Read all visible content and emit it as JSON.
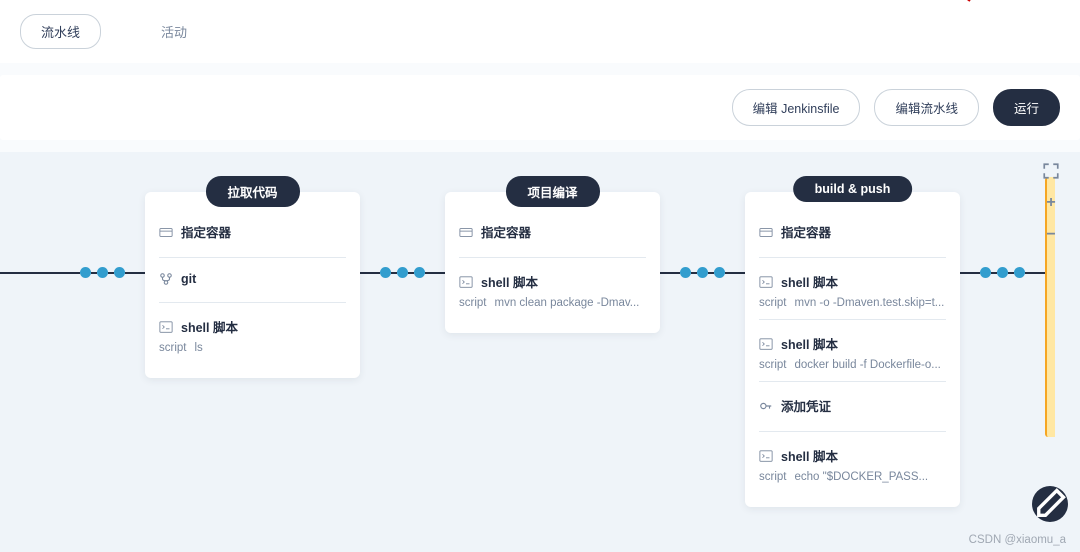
{
  "tabs": {
    "pipeline": "流水线",
    "activity": "活动"
  },
  "toolbar": {
    "edit_jenkinsfile": "编辑 Jenkinsfile",
    "edit_pipeline": "编辑流水线",
    "run": "运行"
  },
  "side_tools": {
    "fullscreen": "⛶",
    "add": "+",
    "remove": "−"
  },
  "stages": [
    {
      "title": "拉取代码",
      "steps": [
        {
          "icon": "container",
          "title": "指定容器"
        },
        {
          "icon": "git",
          "title": "git"
        },
        {
          "icon": "terminal",
          "title": "shell 脚本",
          "detail_key": "script",
          "detail_val": "ls"
        }
      ]
    },
    {
      "title": "项目编译",
      "steps": [
        {
          "icon": "container",
          "title": "指定容器"
        },
        {
          "icon": "terminal",
          "title": "shell 脚本",
          "detail_key": "script",
          "detail_val": "mvn clean package -Dmav..."
        }
      ]
    },
    {
      "title": "build & push",
      "steps": [
        {
          "icon": "container",
          "title": "指定容器"
        },
        {
          "icon": "terminal",
          "title": "shell 脚本",
          "detail_key": "script",
          "detail_val": "mvn -o -Dmaven.test.skip=t..."
        },
        {
          "icon": "terminal",
          "title": "shell 脚本",
          "detail_key": "script",
          "detail_val": "docker build -f Dockerfile-o..."
        },
        {
          "icon": "key",
          "title": "添加凭证"
        },
        {
          "icon": "terminal",
          "title": "shell 脚本",
          "detail_key": "script",
          "detail_val": "echo \"$DOCKER_PASS..."
        }
      ]
    }
  ],
  "watermark": "CSDN @xiaomu_a"
}
